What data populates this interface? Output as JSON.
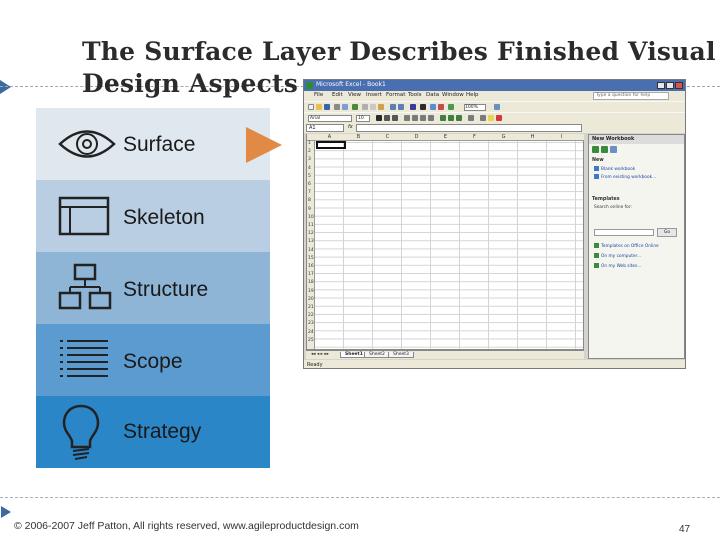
{
  "slide": {
    "title": "The Surface Layer Describes Finished Visual Design Aspects",
    "footer": "© 2006-2007 Jeff Patton, All rights reserved, www.agileproductdesign.com",
    "page_number": "47"
  },
  "layers": [
    {
      "label": "Surface",
      "icon": "eye-icon",
      "color": "#dfe7ef"
    },
    {
      "label": "Skeleton",
      "icon": "wireframe-icon",
      "color": "#b9cee2"
    },
    {
      "label": "Structure",
      "icon": "hierarchy-icon",
      "color": "#8eb4d6"
    },
    {
      "label": "Scope",
      "icon": "list-icon",
      "color": "#5c9bcf"
    },
    {
      "label": "Strategy",
      "icon": "lightbulb-icon",
      "color": "#2a86c7"
    }
  ],
  "colors": {
    "pointer": "#e08a45",
    "accent_marker": "#3a6aa0",
    "excel_title": "#4a6fb0"
  },
  "excel": {
    "title": "Microsoft Excel - Book1",
    "menu": [
      "File",
      "Edit",
      "View",
      "Insert",
      "Format",
      "Tools",
      "Data",
      "Window",
      "Help"
    ],
    "help_placeholder": "Type a question for help",
    "font_name": "Arial",
    "font_size": "10",
    "zoom": "100%",
    "name_box": "A1",
    "fx": "fx",
    "columns": [
      "A",
      "B",
      "C",
      "D",
      "E",
      "F",
      "G",
      "H",
      "I"
    ],
    "rows": [
      "1",
      "2",
      "3",
      "4",
      "5",
      "6",
      "7",
      "8",
      "9",
      "10",
      "11",
      "12",
      "13",
      "14",
      "15",
      "16",
      "17",
      "18",
      "19",
      "20",
      "21",
      "22",
      "23",
      "24",
      "25"
    ],
    "sheets": [
      "Sheet1",
      "Sheet2",
      "Sheet3"
    ],
    "status": "Ready",
    "task_pane": {
      "title": "New Workbook",
      "sections": {
        "new": "New",
        "templates": "Templates"
      },
      "new_links": [
        "Blank workbook",
        "From existing workbook..."
      ],
      "search_label": "Search online for:",
      "go_label": "Go",
      "template_links": [
        "Templates on Office Online",
        "On my computer...",
        "On my Web sites..."
      ]
    }
  }
}
